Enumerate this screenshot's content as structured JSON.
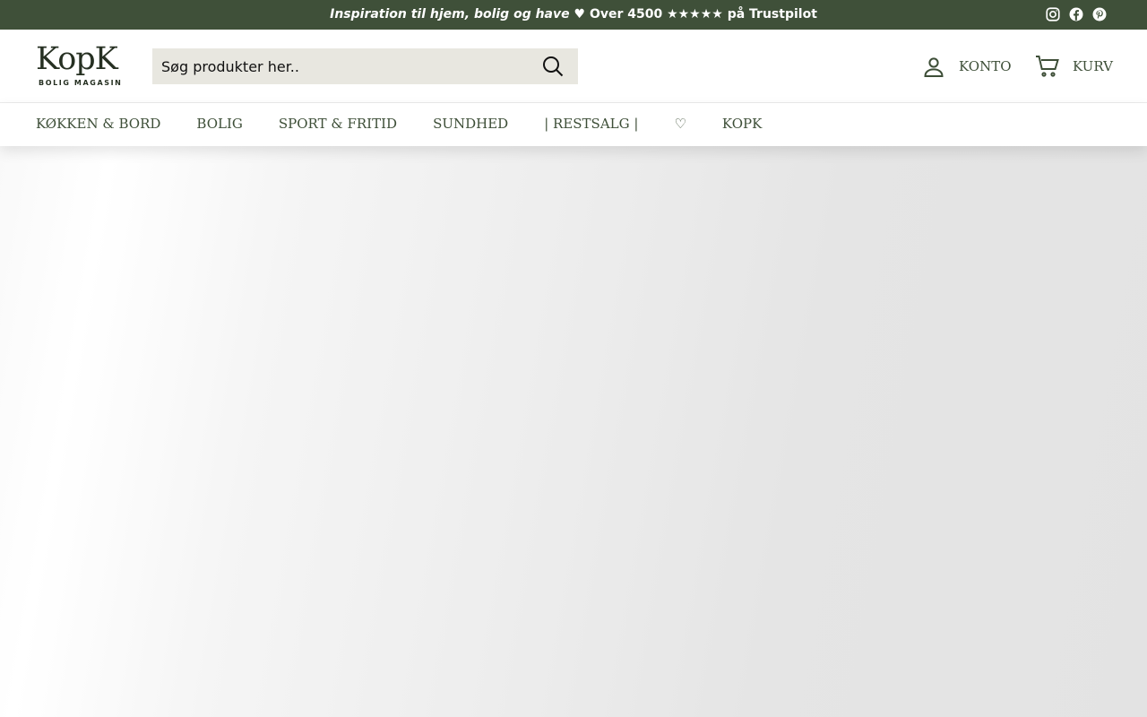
{
  "announcement": {
    "italic_text": "Inspiration til hjem, bolig og have",
    "rest_text": " ♥ Over 4500 ★★★★★ på Trustpilot"
  },
  "social": {
    "instagram_icon": "instagram-icon",
    "facebook_icon": "facebook-icon",
    "pinterest_icon": "pinterest-icon"
  },
  "brand": {
    "name": "KopK",
    "tagline": "BOLIG MAGASIN"
  },
  "search": {
    "placeholder": "Søg produkter her.."
  },
  "header": {
    "account_label": "KONTO",
    "cart_label": "KURV"
  },
  "nav": {
    "items": [
      {
        "label": "KØKKEN & BORD"
      },
      {
        "label": "BOLIG"
      },
      {
        "label": "SPORT & FRITID"
      },
      {
        "label": "SUNDHED"
      },
      {
        "label": "| RESTSALG |"
      },
      {
        "label": "♡"
      },
      {
        "label": "KOPK"
      }
    ]
  },
  "colors": {
    "announcement_bg": "#3f5039",
    "accent_text": "#3d4e37",
    "search_bg": "#e8e7e0"
  }
}
